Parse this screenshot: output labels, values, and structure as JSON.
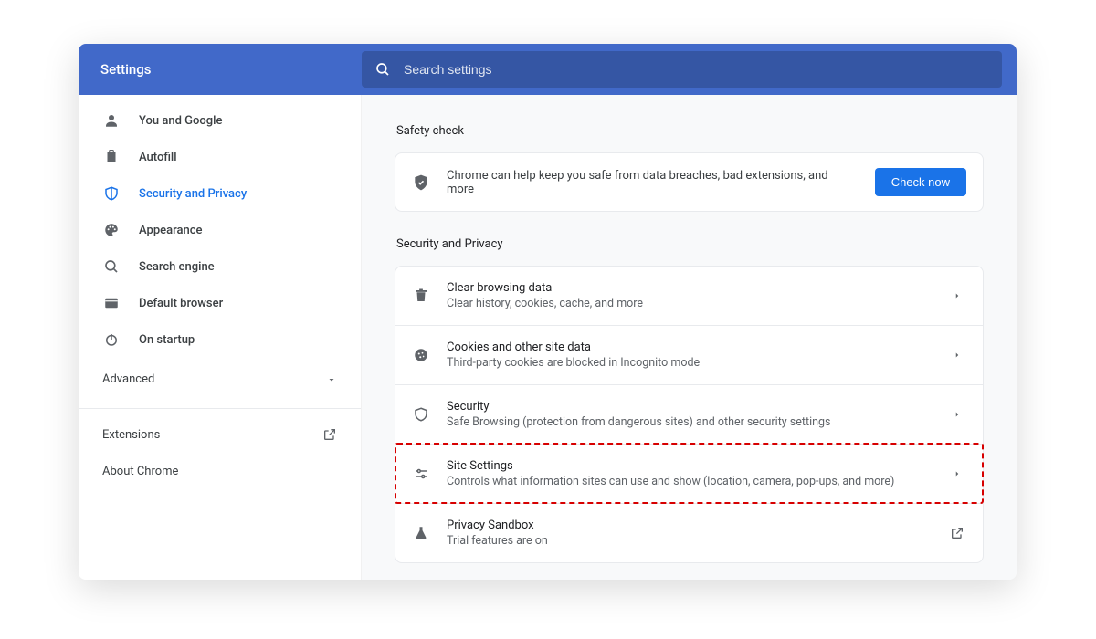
{
  "header": {
    "title": "Settings",
    "search_placeholder": "Search settings"
  },
  "sidebar": {
    "items": [
      {
        "label": "You and Google"
      },
      {
        "label": "Autofill"
      },
      {
        "label": "Security and Privacy"
      },
      {
        "label": "Appearance"
      },
      {
        "label": "Search engine"
      },
      {
        "label": "Default browser"
      },
      {
        "label": "On startup"
      }
    ],
    "advanced_label": "Advanced",
    "extensions_label": "Extensions",
    "about_label": "About Chrome"
  },
  "main": {
    "safety_check": {
      "heading": "Safety check",
      "desc": "Chrome can help keep you safe from data breaches, bad extensions, and more",
      "button": "Check now"
    },
    "sec_priv": {
      "heading": "Security and Privacy",
      "rows": [
        {
          "title": "Clear browsing data",
          "sub": "Clear history, cookies, cache, and more"
        },
        {
          "title": "Cookies and other site data",
          "sub": "Third-party cookies are blocked in Incognito mode"
        },
        {
          "title": "Security",
          "sub": "Safe Browsing (protection from dangerous sites) and other security settings"
        },
        {
          "title": "Site Settings",
          "sub": "Controls what information sites can use and show (location, camera, pop-ups, and more)"
        },
        {
          "title": "Privacy Sandbox",
          "sub": "Trial features are on"
        }
      ]
    }
  }
}
